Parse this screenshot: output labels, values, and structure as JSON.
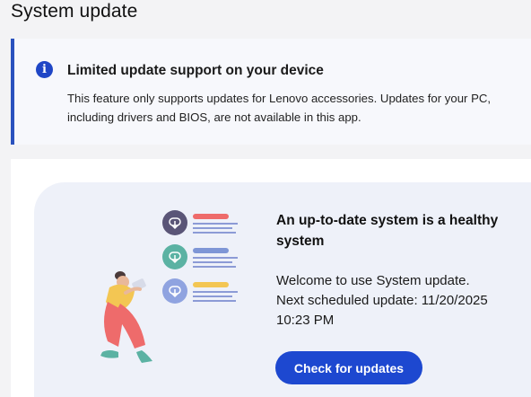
{
  "page": {
    "title": "System update"
  },
  "notice": {
    "icon": "info-icon",
    "icon_glyph": "i",
    "title": "Limited update support on your device",
    "body": "This feature only supports updates for Lenovo accessories. Updates for your PC, including drivers and BIOS, are not available in this app."
  },
  "status": {
    "illustration": "person-with-cloud-download-cards",
    "heading": "An up-to-date system is a healthy system",
    "welcome": "Welcome to use System update.",
    "next_update_label": "Next scheduled update: 11/20/2025 10:23 PM",
    "check_button_label": "Check for updates"
  },
  "colors": {
    "accent": "#1d48d0",
    "banner_border": "#2a52be",
    "panel_bg": "#eef1f9"
  }
}
